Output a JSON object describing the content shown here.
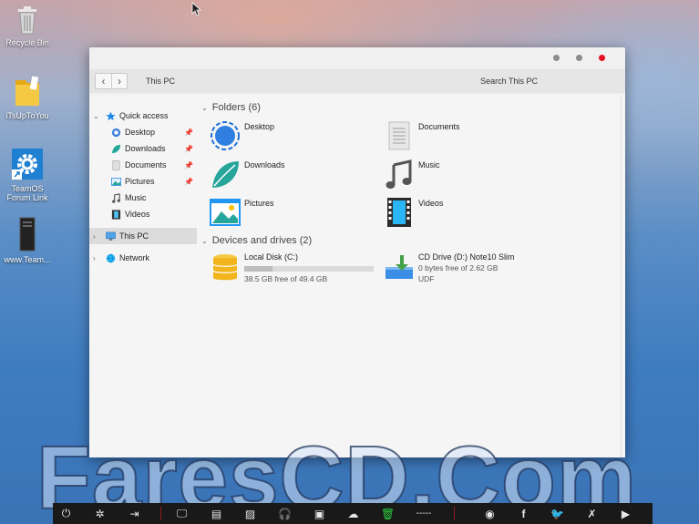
{
  "desktop": {
    "icons": [
      {
        "label": "Recycle Bin",
        "icon": "recycle-bin-icon"
      },
      {
        "label": "iTsUpToYou",
        "icon": "folder-icon"
      },
      {
        "label": "TeamOS",
        "label2": "Forum Link",
        "icon": "gear-shortcut-icon"
      },
      {
        "label": "www.Team...",
        "icon": "pc-tower-icon"
      }
    ]
  },
  "window": {
    "address": "This PC",
    "search_placeholder": "Search This PC",
    "controls": [
      "minimize",
      "maximize",
      "close"
    ],
    "close_color": "#e81123"
  },
  "sidebar": {
    "quick_access": "Quick access",
    "items": [
      {
        "label": "Desktop",
        "icon": "desktop-circle-icon",
        "pinned": true
      },
      {
        "label": "Downloads",
        "icon": "leaf-icon",
        "pinned": true
      },
      {
        "label": "Documents",
        "icon": "document-icon",
        "pinned": true
      },
      {
        "label": "Pictures",
        "icon": "picture-icon",
        "pinned": true
      },
      {
        "label": "Music",
        "icon": "music-note-icon",
        "pinned": false
      },
      {
        "label": "Videos",
        "icon": "film-icon",
        "pinned": false
      }
    ],
    "this_pc": "This PC",
    "network": "Network"
  },
  "folders": {
    "header": "Folders (6)",
    "items": [
      "Desktop",
      "Documents",
      "Downloads",
      "Music",
      "Pictures",
      "Videos"
    ]
  },
  "drives": {
    "header": "Devices and drives (2)",
    "local": {
      "name": "Local Disk (C:)",
      "free": "38.5 GB free of 49.4 GB",
      "used_fraction": 0.22
    },
    "cd": {
      "name": "CD Drive (D:) Note10 Slim",
      "free": "0 bytes free of 2.62 GB",
      "fs": "UDF"
    }
  },
  "watermark": "FaresCD.Com",
  "taskbar": {
    "clock": "-----",
    "icons": [
      "power-icon",
      "settings-icon",
      "logout-icon",
      "monitor-icon",
      "document-icon",
      "images-icon",
      "headphones-icon",
      "film-strip-icon",
      "cloud-download-icon",
      "trash-icon",
      "chrome-icon",
      "facebook-icon",
      "twitter-icon",
      "tools-icon",
      "youtube-icon"
    ],
    "trash_color": "#2ecc40"
  }
}
